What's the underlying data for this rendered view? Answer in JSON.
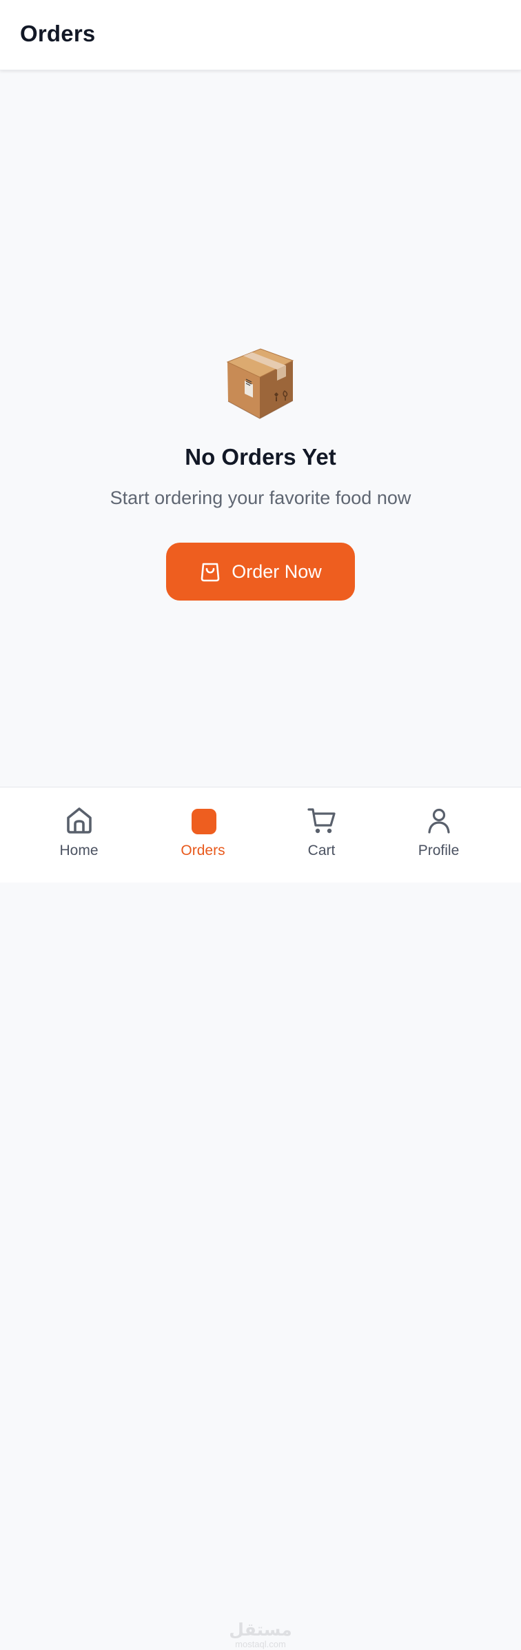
{
  "header": {
    "title": "Orders"
  },
  "empty_state": {
    "icon": "package-box-emoji",
    "title": "No Orders Yet",
    "subtitle": "Start ordering your favorite food now",
    "button_label": "Order Now",
    "button_icon": "shopping-bag-icon"
  },
  "bottom_nav": {
    "items": [
      {
        "label": "Home",
        "icon": "home-icon",
        "active": false
      },
      {
        "label": "Orders",
        "icon": "orders-icon",
        "active": true
      },
      {
        "label": "Cart",
        "icon": "cart-icon",
        "active": false
      },
      {
        "label": "Profile",
        "icon": "profile-icon",
        "active": false
      }
    ]
  },
  "watermark": {
    "text": "مستقل",
    "subtext": "mostaql.com"
  },
  "colors": {
    "accent": "#ee5e1f",
    "header_bg": "#ffffff",
    "page_bg": "#f8f9fb",
    "title_text": "#121826",
    "muted_text": "#5f6672",
    "nav_text": "#4b5261"
  }
}
